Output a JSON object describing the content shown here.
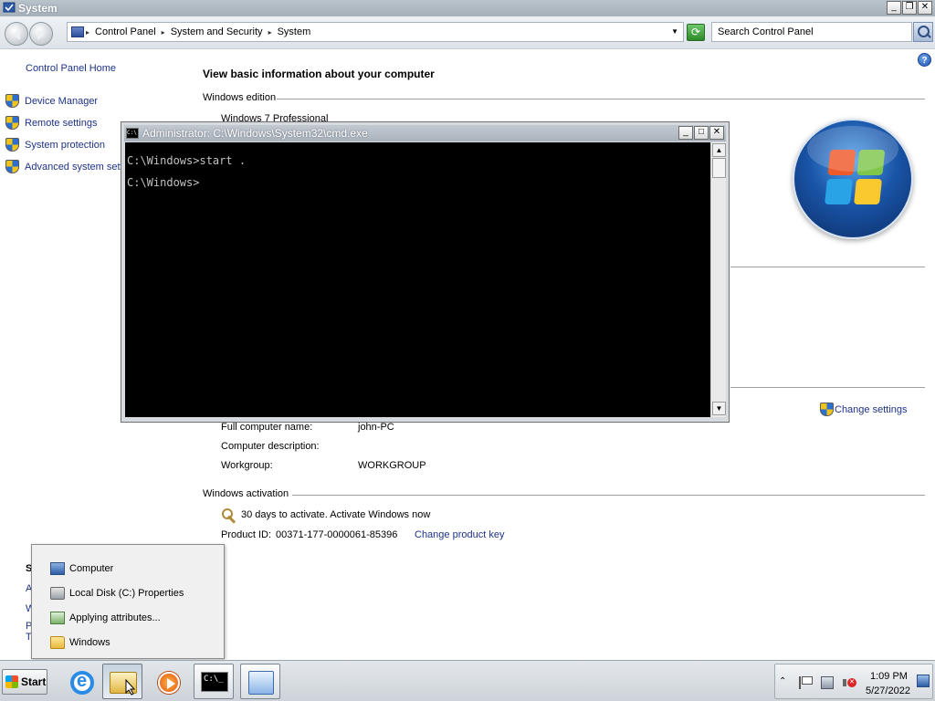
{
  "window": {
    "title": "System",
    "icon": "system-icon",
    "minimize": "_",
    "restore": "❐",
    "close": "✕"
  },
  "address_bar": {
    "breadcrumbs": [
      "Control Panel",
      "System and Security",
      "System"
    ],
    "search_placeholder": "Search Control Panel"
  },
  "left_pane": {
    "home_link": "Control Panel Home",
    "links": [
      "Device Manager",
      "Remote settings",
      "System protection",
      "Advanced system settings"
    ],
    "see_also_fragments": [
      "S",
      "A",
      "W",
      "P",
      "T"
    ]
  },
  "main": {
    "heading": "View basic information about your computer",
    "help": "?",
    "sections": {
      "edition": {
        "title": "Windows edition",
        "value": "Windows 7 Professional"
      },
      "computer_name": {
        "change_settings": "Change settings",
        "rows": [
          {
            "label": "Full computer name:",
            "value": "john-PC"
          },
          {
            "label": "Computer description:",
            "value": ""
          },
          {
            "label": "Workgroup:",
            "value": "WORKGROUP"
          }
        ]
      },
      "activation": {
        "title": "Windows activation",
        "status": "30 days to activate. Activate Windows now",
        "product_id_label": "Product ID:",
        "product_id": "00371-177-0000061-85396",
        "change_key": "Change product key"
      }
    }
  },
  "cmd": {
    "title": "Administrator: C:\\Windows\\System32\\cmd.exe",
    "icon_text": "C:\\",
    "lines": [
      "C:\\Windows>start .",
      "C:\\Windows>"
    ],
    "minimize": "_",
    "maximize": "□",
    "close": "✕",
    "scroll_up": "▲",
    "scroll_down": "▼"
  },
  "jump_list": {
    "items": [
      "Computer",
      "Local Disk (C:) Properties",
      "Applying attributes...",
      "Windows"
    ]
  },
  "taskbar": {
    "start_label": "Start",
    "cmd_icon_text": "C:\\_",
    "clock_time": "1:09 PM",
    "clock_date": "5/27/2022"
  }
}
